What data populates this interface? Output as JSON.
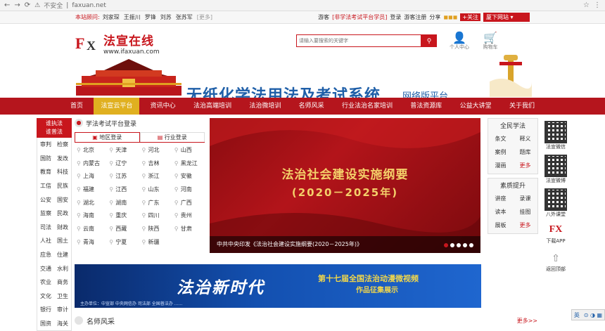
{
  "browser": {
    "back": "←",
    "forward": "→",
    "reload": "⟳",
    "insecure": "不安全",
    "url": "faxuan.net",
    "star": "☆",
    "menu": "⋮"
  },
  "topbar": {
    "advisors_label": "本站顾问:",
    "advisors": [
      "刘家琛",
      "王振川",
      "罗锋",
      "刘苏",
      "张苏军"
    ],
    "more": "[更多]",
    "guest": "游客",
    "login_link": "[非学法考试平台学员]",
    "login": "登录",
    "register": "游客注册",
    "share": "分享",
    "follow": "+关注",
    "site_select": "厦下网站"
  },
  "header": {
    "logo_cn": "法宣在线",
    "logo_en": "www.ifaxuan.com",
    "search_placeholder": "请输入要搜索的关键字",
    "user_center": "个人中心",
    "cart": "购物车",
    "slogan": "无纸化学法用法及考试系统",
    "slogan_sub": "网络版平台"
  },
  "nav": [
    "首页",
    "法宣云平台",
    "资讯中心",
    "法治高端培训",
    "法治微培训",
    "名师风采",
    "行业法治名家培训",
    "普法资源库",
    "公益大讲堂",
    "关于我们"
  ],
  "nav_active": 1,
  "left_column": {
    "header": [
      "谁执法",
      "谁普法"
    ],
    "rows": [
      [
        "审判",
        "检察"
      ],
      [
        "国防",
        "发改"
      ],
      [
        "教育",
        "科技"
      ],
      [
        "工信",
        "民族"
      ],
      [
        "公安",
        "国安"
      ],
      [
        "监察",
        "民政"
      ],
      [
        "司法",
        "财政"
      ],
      [
        "人社",
        "国土"
      ],
      [
        "应急",
        "住建"
      ],
      [
        "交通",
        "水利"
      ],
      [
        "农业",
        "商务"
      ],
      [
        "文化",
        "卫生"
      ],
      [
        "银行",
        "审计"
      ],
      [
        "国资",
        "海关"
      ]
    ]
  },
  "login_panel": {
    "title": "学法考试平台登录",
    "tab_region": "地区登录",
    "tab_industry": "行业登录",
    "regions": [
      "北京",
      "天津",
      "河北",
      "山西",
      "内蒙古",
      "辽宁",
      "吉林",
      "黑龙江",
      "上海",
      "江苏",
      "浙江",
      "安徽",
      "福建",
      "江西",
      "山东",
      "河南",
      "湖北",
      "湖南",
      "广东",
      "广西",
      "海南",
      "重庆",
      "四川",
      "贵州",
      "云南",
      "西藏",
      "陕西",
      "甘肃",
      "青海",
      "宁夏",
      "新疆"
    ]
  },
  "banner": {
    "title": "法治社会建设实施纲要",
    "subtitle": "(2020－2025年)",
    "caption": "中共中央印发《法治社会建设实施纲要(2020－2025年)》"
  },
  "right_boxes": [
    {
      "title": "全民学法",
      "items": [
        "条文",
        "释义",
        "案例",
        "题库",
        "漫画",
        "更多"
      ]
    },
    {
      "title": "素质提升",
      "items": [
        "讲座",
        "录课",
        "读本",
        "挂图",
        "展板",
        "更多"
      ]
    }
  ],
  "sidebar": {
    "wechat": "法宣微信",
    "weibo": "法宣微博",
    "class": "八外课堂",
    "app_logo": "FX",
    "app": "下载APP",
    "top": "返回顶部"
  },
  "wide_banner": {
    "main": "法治新时代",
    "right1": "第十七届全国法治动漫微视频",
    "right2": "作品征集展示",
    "foot": "主办单位：中宣部 中央网信办 司法部 全国普法办 ……"
  },
  "section": {
    "title": "名师风采",
    "more": "更多>>"
  },
  "ime": {
    "lang": "英",
    "icons": "⊙ ◑ ▦"
  },
  "colors": {
    "brand_red": "#c8161d",
    "nav_red": "#b5151d",
    "active_gold": "#e0b020",
    "slogan_blue": "#1f5fa8"
  }
}
